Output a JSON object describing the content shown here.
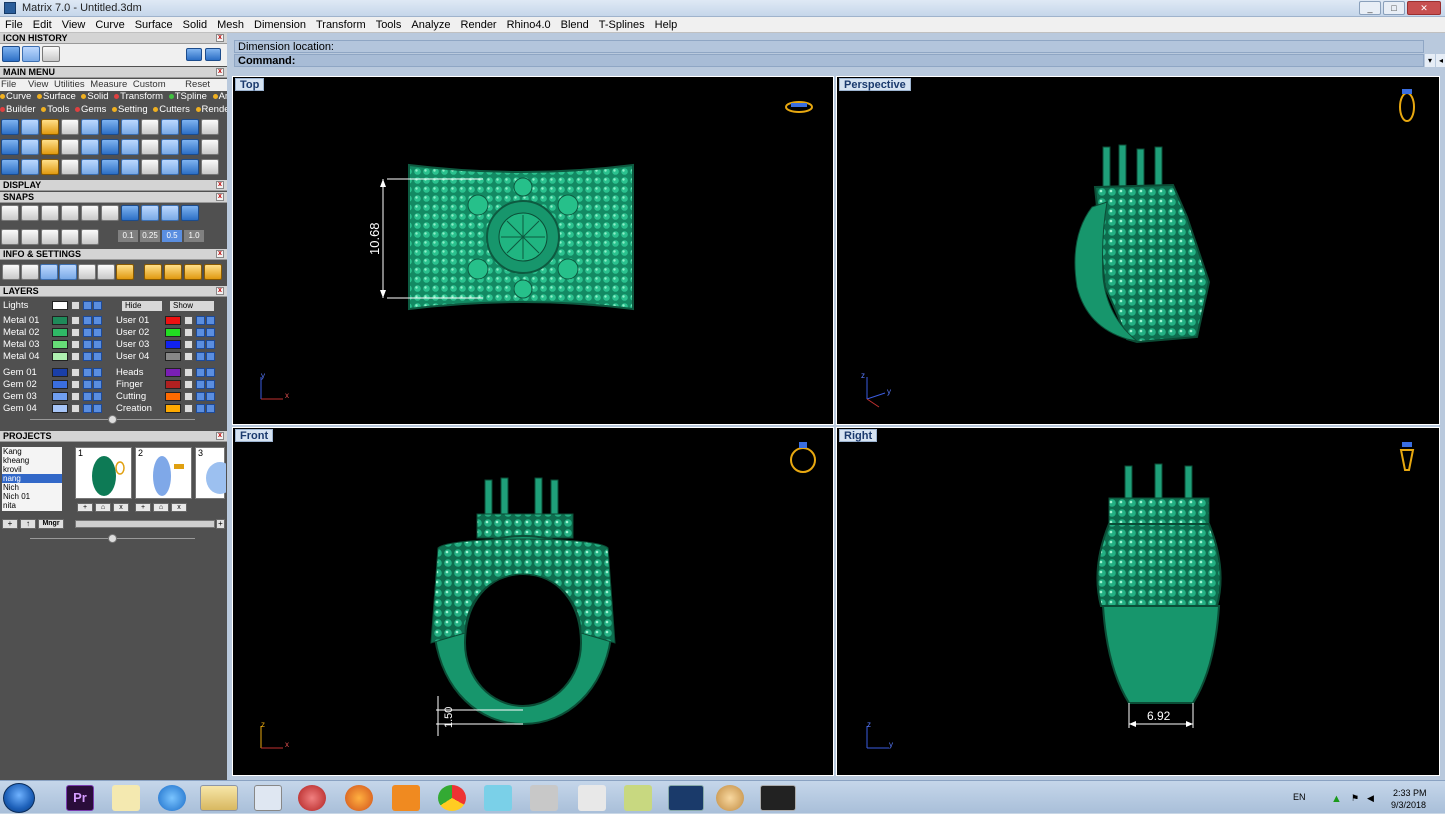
{
  "window": {
    "title": "Matrix 7.0 - Untitled.3dm",
    "controls": [
      "_",
      "□",
      "✕"
    ]
  },
  "menu": [
    "File",
    "Edit",
    "View",
    "Curve",
    "Surface",
    "Solid",
    "Mesh",
    "Dimension",
    "Transform",
    "Tools",
    "Analyze",
    "Render",
    "Rhino4.0",
    "Blend",
    "T-Splines",
    "Help"
  ],
  "left": {
    "icon_history": "ICON HISTORY",
    "main_menu": "MAIN MENU",
    "main_menu_tabs": [
      "File",
      "View",
      "Utilities",
      "Measure",
      "Custom"
    ],
    "main_menu_reset": "Reset",
    "cat_row1": [
      "Curve",
      "Surface",
      "Solid",
      "Transform",
      "TSpline",
      "Art"
    ],
    "cat_row2": [
      "Builder",
      "Tools",
      "Gems",
      "Setting",
      "Cutters",
      "Render"
    ],
    "display": "DISPLAY",
    "snaps": "SNAPS",
    "snap_values": [
      "0.1",
      "0.25",
      "0.5",
      "1.0"
    ],
    "info_settings": "INFO & SETTINGS",
    "layers": "LAYERS",
    "lights": "Lights",
    "hide": "Hide",
    "show": "Show",
    "layers_left": [
      {
        "name": "Metal 01",
        "color": "#1f8a5a"
      },
      {
        "name": "Metal 02",
        "color": "#2fb866"
      },
      {
        "name": "Metal 03",
        "color": "#66dd77"
      },
      {
        "name": "Metal 04",
        "color": "#aef0b0"
      },
      {
        "name": "Gem 01",
        "color": "#1a3fa8"
      },
      {
        "name": "Gem 02",
        "color": "#3a6ee0"
      },
      {
        "name": "Gem 03",
        "color": "#6f9ef0"
      },
      {
        "name": "Gem 04",
        "color": "#a8c6f8"
      }
    ],
    "layers_right": [
      {
        "name": "User 01",
        "color": "#ee1111"
      },
      {
        "name": "User 02",
        "color": "#22dd22"
      },
      {
        "name": "User 03",
        "color": "#1122ee"
      },
      {
        "name": "User 04",
        "color": "#888888"
      },
      {
        "name": "Heads",
        "color": "#7a1fb5"
      },
      {
        "name": "Finger",
        "color": "#b02020"
      },
      {
        "name": "Cutting",
        "color": "#ff6a00"
      },
      {
        "name": "Creation",
        "color": "#ffaa00"
      }
    ],
    "projects": "PROJECTS",
    "project_names": [
      "Kang",
      "kheang",
      "krovil",
      "nang",
      "Nich",
      "Nich 01",
      "nita"
    ],
    "project_selected": "nang",
    "thumb_numbers": [
      "1",
      "2",
      "3"
    ],
    "mngr": "Mngr"
  },
  "command": {
    "dimension_location": "Dimension location:",
    "command_label": "Command:"
  },
  "viewports": {
    "top": {
      "label": "Top",
      "dimension": "10.68",
      "axis_x": "x",
      "axis_y": "y"
    },
    "perspective": {
      "label": "Perspective",
      "axis_x": "y",
      "axis_y": "z"
    },
    "front": {
      "label": "Front",
      "dimension": "1.50",
      "axis_x": "x",
      "axis_y": "z"
    },
    "right": {
      "label": "Right",
      "dimension": "6.92",
      "axis_x": "y",
      "axis_y": "z"
    }
  },
  "taskbar": {
    "lang": "EN",
    "time": "2:33 PM",
    "date": "9/3/2018",
    "premiere_label": "Pr"
  },
  "colors": {
    "model_green": "#1fa07a",
    "model_dark": "#0d5a40",
    "viewport_bg": "#000000",
    "label_blue": "#1b3a6d"
  }
}
